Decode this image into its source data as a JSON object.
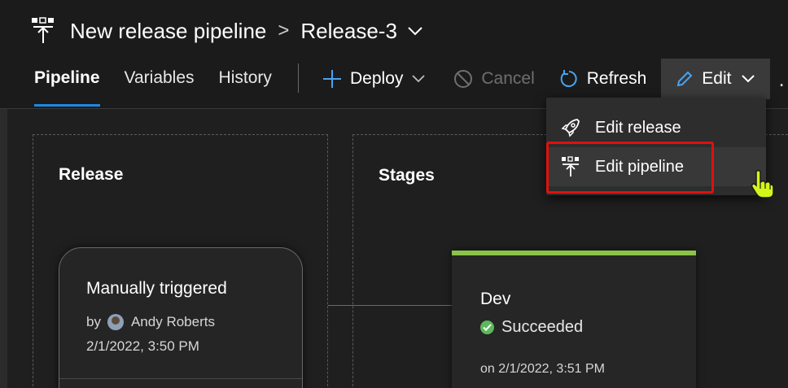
{
  "header": {
    "app_title": "New release pipeline",
    "breadcrumb_separator": ">",
    "release_name": "Release-3"
  },
  "tabs": [
    {
      "label": "Pipeline",
      "active": true
    },
    {
      "label": "Variables",
      "active": false
    },
    {
      "label": "History",
      "active": false
    }
  ],
  "toolbar": {
    "deploy_label": "Deploy",
    "cancel_label": "Cancel",
    "refresh_label": "Refresh",
    "edit_label": "Edit",
    "more_label": "..."
  },
  "edit_menu": {
    "items": [
      {
        "label": "Edit release",
        "icon": "rocket-icon"
      },
      {
        "label": "Edit pipeline",
        "icon": "pipeline-icon"
      }
    ]
  },
  "release_panel": {
    "title": "Release",
    "card": {
      "trigger": "Manually triggered",
      "by_prefix": "by",
      "user": "Andy Roberts",
      "date": "2/1/2022, 3:50 PM"
    }
  },
  "stages_panel": {
    "title": "Stages",
    "stage": {
      "name": "Dev",
      "status": "Succeeded",
      "date": "on 2/1/2022, 3:51 PM"
    }
  },
  "colors": {
    "accent": "#1e88e5",
    "success": "#8bc34a",
    "highlight": "#e01010"
  }
}
